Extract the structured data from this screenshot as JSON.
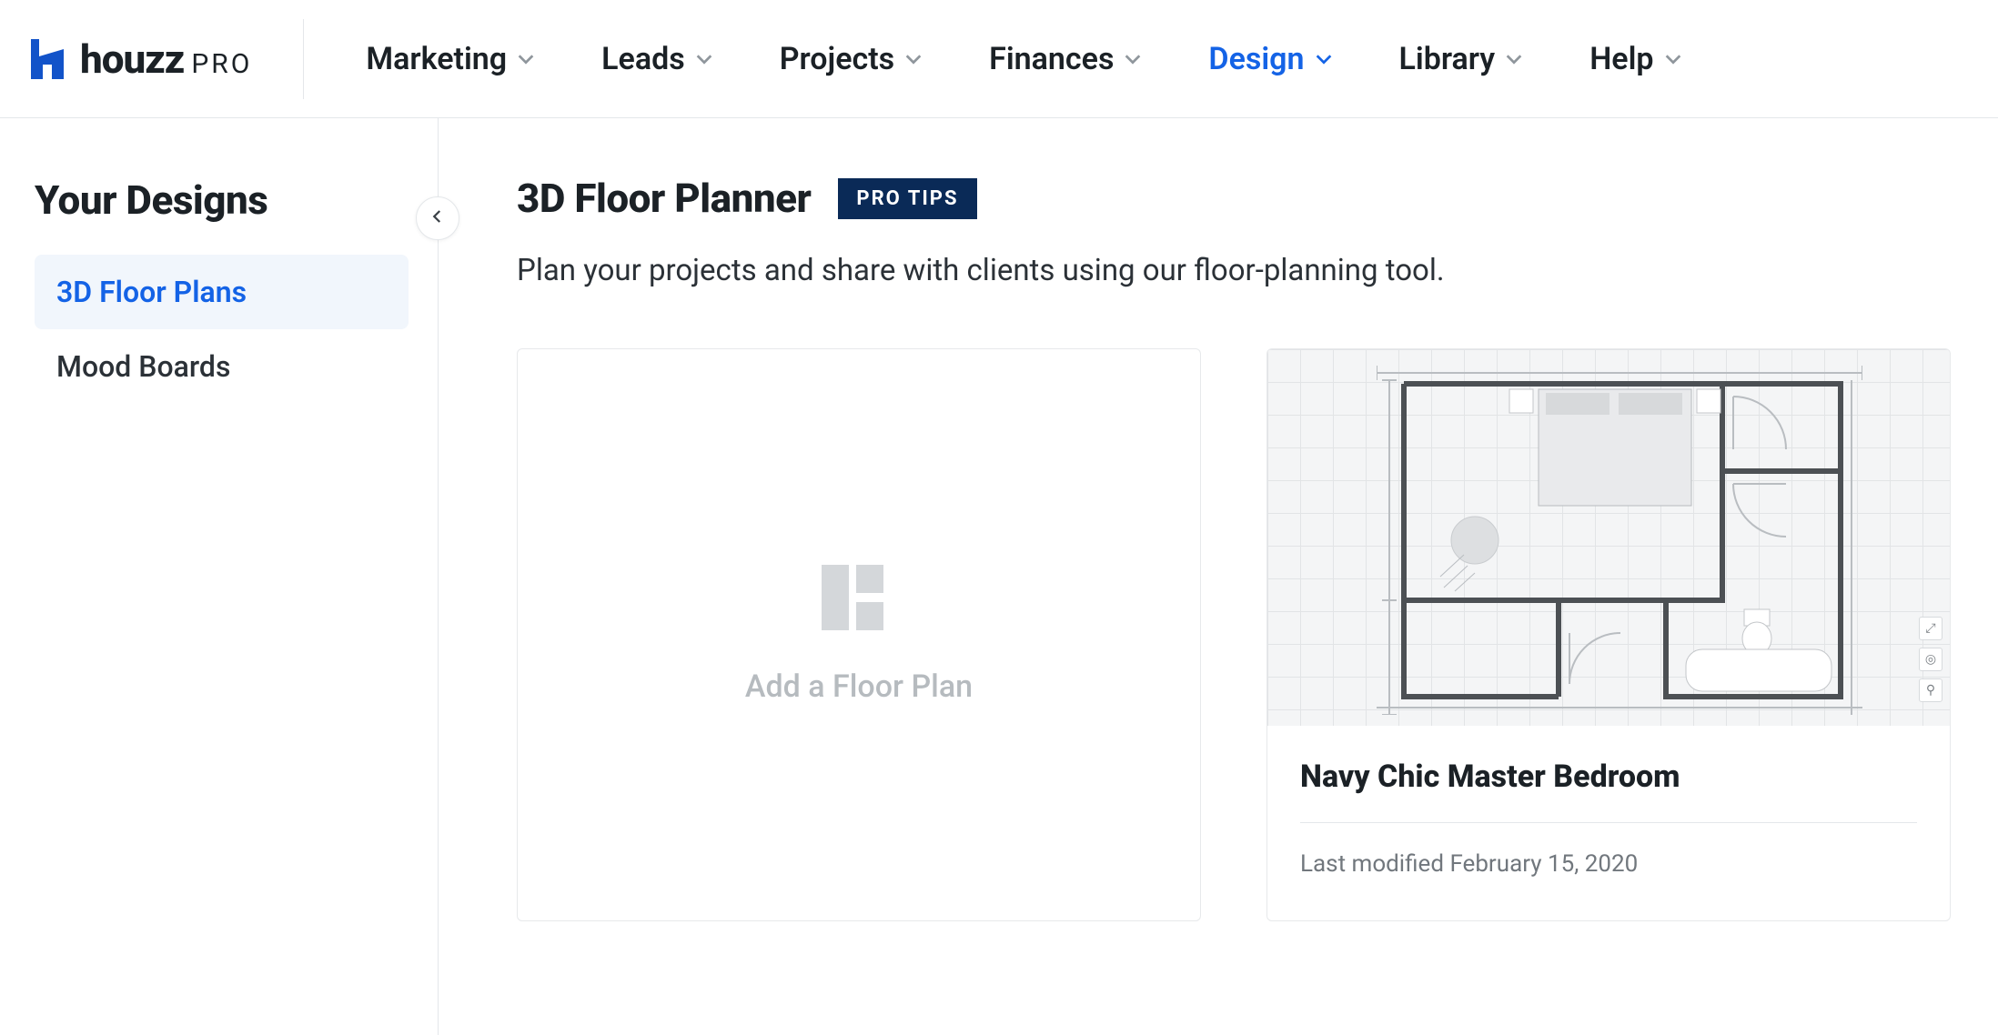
{
  "brand": {
    "wordmark": "houzz",
    "pro": "PRO"
  },
  "nav": {
    "items": [
      {
        "label": "Marketing",
        "active": false
      },
      {
        "label": "Leads",
        "active": false
      },
      {
        "label": "Projects",
        "active": false
      },
      {
        "label": "Finances",
        "active": false
      },
      {
        "label": "Design",
        "active": true
      },
      {
        "label": "Library",
        "active": false
      },
      {
        "label": "Help",
        "active": false
      }
    ]
  },
  "sidebar": {
    "title": "Your Designs",
    "items": [
      {
        "label": "3D Floor Plans",
        "active": true
      },
      {
        "label": "Mood Boards",
        "active": false
      }
    ]
  },
  "main": {
    "title": "3D Floor Planner",
    "pro_tips_label": "PRO TIPS",
    "subtitle": "Plan your projects and share with clients using our floor-planning tool.",
    "add_card_label": "Add a Floor Plan",
    "plan": {
      "title": "Navy Chic Master Bedroom",
      "last_modified": "Last modified February 15, 2020"
    }
  }
}
